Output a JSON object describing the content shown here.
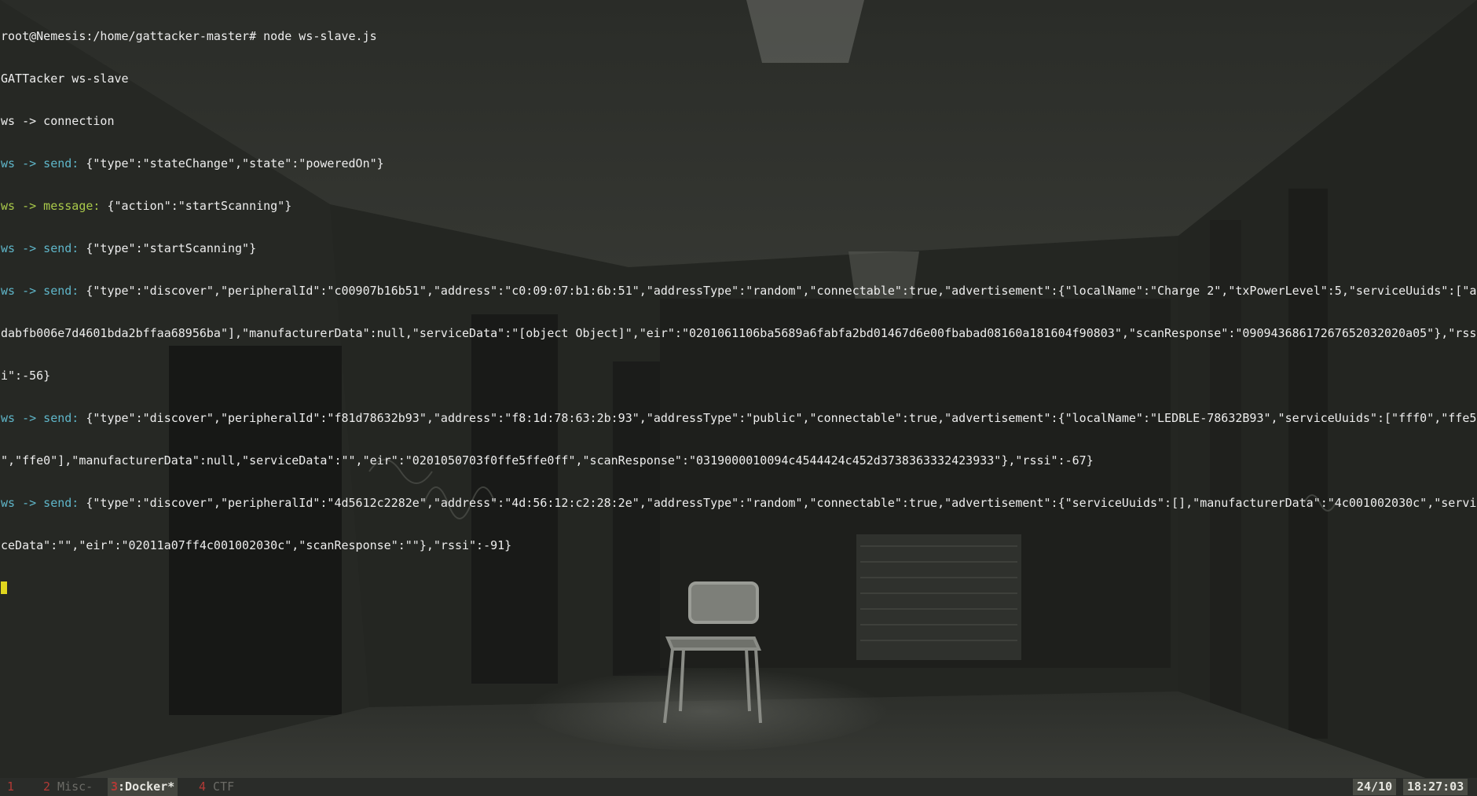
{
  "terminal": {
    "lines": [
      {
        "plain": "root@Nemesis:/home/gattacker-master# node ws-slave.js"
      },
      {
        "plain": "GATTacker ws-slave"
      },
      {
        "plain": "ws -> connection"
      },
      {
        "prefix": "ws -> send:",
        "kind": "ws",
        "rest": " {\"type\":\"stateChange\",\"state\":\"poweredOn\"}"
      },
      {
        "prefix": "ws -> message:",
        "kind": "msg",
        "rest": " {\"action\":\"startScanning\"}"
      },
      {
        "prefix": "ws -> send:",
        "kind": "ws",
        "rest": " {\"type\":\"startScanning\"}"
      },
      {
        "prefix": "ws -> send:",
        "kind": "ws",
        "rest": " {\"type\":\"discover\",\"peripheralId\":\"c00907b16b51\",\"address\":\"c0:09:07:b1:6b:51\",\"addressType\":\"random\",\"connectable\":true,\"advertisement\":{\"localName\":\"Charge 2\",\"txPowerLevel\":5,\"serviceUuids\":[\"a"
      },
      {
        "plain": "dabfb006e7d4601bda2bffaa68956ba\"],\"manufacturerData\":null,\"serviceData\":\"[object Object]\",\"eir\":\"0201061106ba5689a6fabfa2bd01467d6e00fbabad08160a181604f90803\",\"scanResponse\":\"09094368617267652032020a05\"},\"rss"
      },
      {
        "plain": "i\":-56}"
      },
      {
        "prefix": "ws -> send:",
        "kind": "ws",
        "rest": " {\"type\":\"discover\",\"peripheralId\":\"f81d78632b93\",\"address\":\"f8:1d:78:63:2b:93\",\"addressType\":\"public\",\"connectable\":true,\"advertisement\":{\"localName\":\"LEDBLE-78632B93\",\"serviceUuids\":[\"fff0\",\"ffe5"
      },
      {
        "plain": "\",\"ffe0\"],\"manufacturerData\":null,\"serviceData\":\"\",\"eir\":\"0201050703f0ffe5ffe0ff\",\"scanResponse\":\"0319000010094c4544424c452d3738363332423933\"},\"rssi\":-67}"
      },
      {
        "prefix": "ws -> send:",
        "kind": "ws",
        "rest": " {\"type\":\"discover\",\"peripheralId\":\"4d5612c2282e\",\"address\":\"4d:56:12:c2:28:2e\",\"addressType\":\"random\",\"connectable\":true,\"advertisement\":{\"serviceUuids\":[],\"manufacturerData\":\"4c001002030c\",\"servi"
      },
      {
        "plain": "ceData\":\"\",\"eir\":\"02011a07ff4c001002030c\",\"scanResponse\":\"\"},\"rssi\":-91}"
      }
    ]
  },
  "statusbar": {
    "windows": [
      {
        "index": "1",
        "name": ""
      },
      {
        "index": "2",
        "name": " Misc-"
      },
      {
        "index": "3",
        "name": ":Docker*"
      },
      {
        "index": "4",
        "name": " CTF"
      }
    ],
    "position": "24/10",
    "clock": "18:27:03"
  },
  "colors": {
    "prefix_send": "#5fb6c9",
    "prefix_message": "#a9c94a",
    "cursor": "#e0d61e",
    "window_index": "#b23a36"
  }
}
